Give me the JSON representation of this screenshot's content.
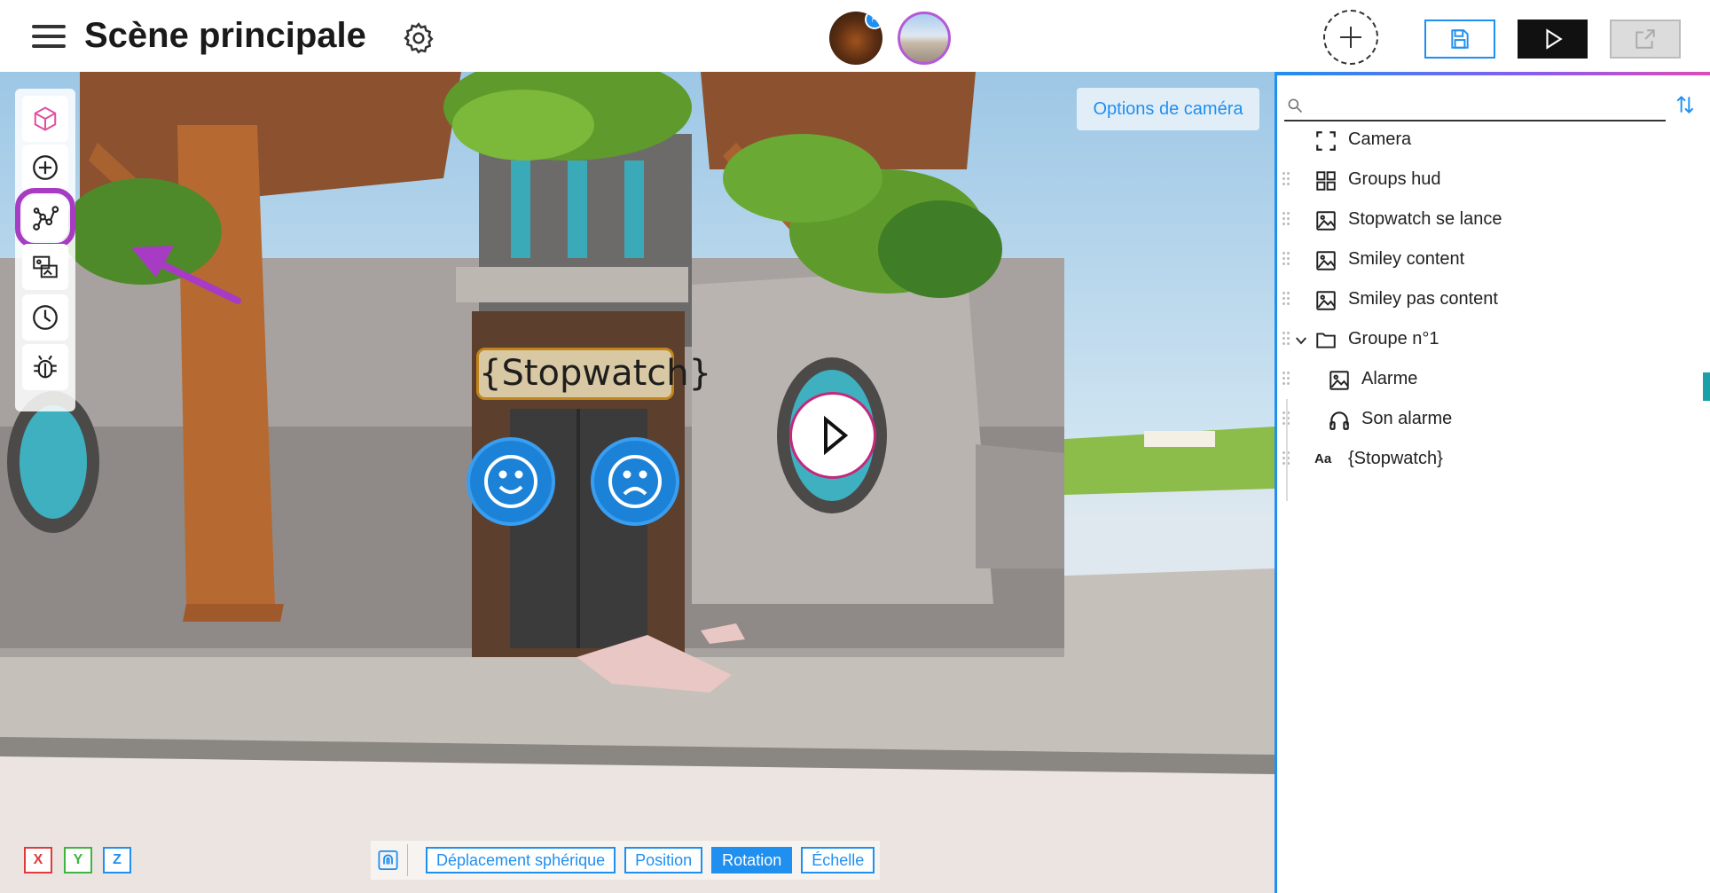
{
  "header": {
    "title": "Scène principale",
    "scene_thumb_badge": "⚑"
  },
  "viewport": {
    "camera_options_label": "Options de caméra",
    "stopwatch_text": "{Stopwatch}",
    "axes": [
      {
        "label": "X",
        "color": "#e03a3a"
      },
      {
        "label": "Y",
        "color": "#3fb43f"
      },
      {
        "label": "Z",
        "color": "#1f8ff0"
      }
    ],
    "transform_modes": [
      "Déplacement sphérique",
      "Position",
      "Rotation",
      "Échelle"
    ],
    "active_mode": "Rotation"
  },
  "toolbar": {
    "tools": [
      "cube-icon",
      "add-icon",
      "graph-nodes-icon",
      "image-swap-icon",
      "clock-icon",
      "bug-icon"
    ],
    "highlighted_tool": "graph-nodes-icon"
  },
  "panel": {
    "search_placeholder": "",
    "tree": [
      {
        "label": "Camera",
        "icon": "camera-frame-icon"
      },
      {
        "label": "Groups hud",
        "icon": "grid-icon"
      },
      {
        "label": "Stopwatch se lance",
        "icon": "image-icon"
      },
      {
        "label": "Smiley content",
        "icon": "image-icon"
      },
      {
        "label": "Smiley pas content",
        "icon": "image-icon"
      },
      {
        "label": "Groupe n°1",
        "icon": "folder-icon"
      },
      {
        "label": "Alarme",
        "icon": "image-icon"
      },
      {
        "label": "Son alarme",
        "icon": "headphones-icon"
      },
      {
        "label": "{Stopwatch}",
        "icon": "text-icon"
      }
    ],
    "text_icon_glyph": "Aa"
  },
  "colors": {
    "accent": "#1f8ff0",
    "highlight": "#a83bc4"
  }
}
